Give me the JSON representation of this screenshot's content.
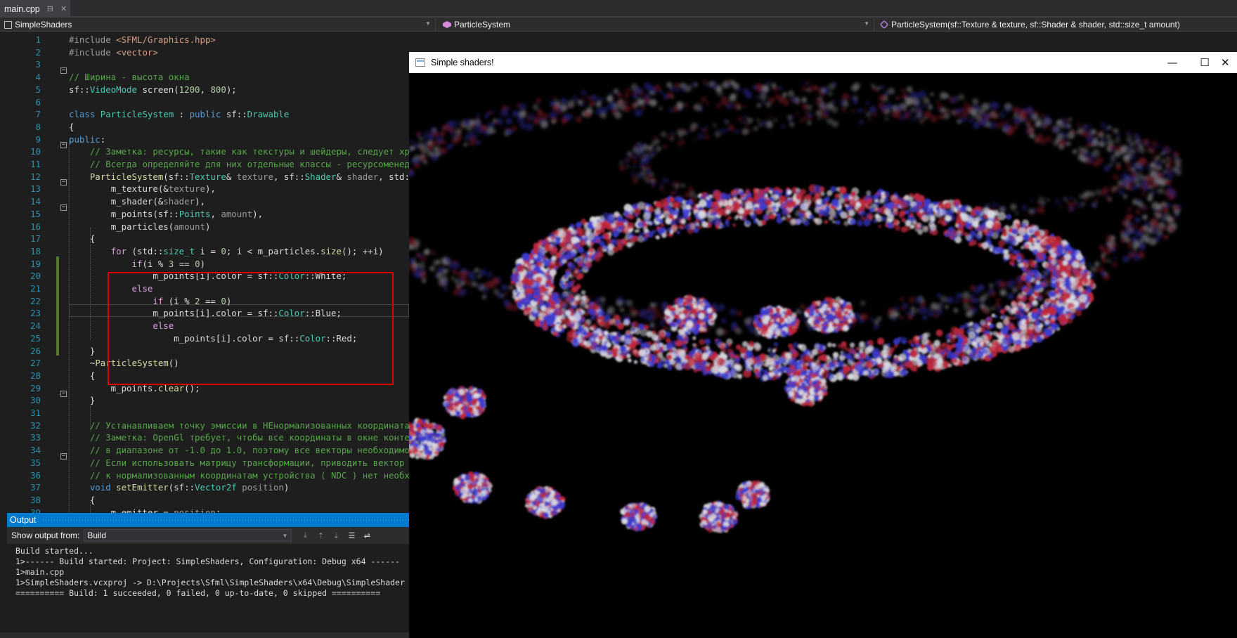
{
  "tab": {
    "title": "main.cpp"
  },
  "nav": {
    "project": "SimpleShaders",
    "class": "ParticleSystem",
    "member": "ParticleSystem(sf::Texture & texture, sf::Shader & shader, std::size_t amount)"
  },
  "code_lines": [
    {
      "n": "1",
      "t": [
        [
          "pp",
          "#include "
        ],
        [
          "str",
          "<SFML/Graphics.hpp>"
        ]
      ]
    },
    {
      "n": "2",
      "t": [
        [
          "pp",
          "#include "
        ],
        [
          "str",
          "<vector>"
        ]
      ]
    },
    {
      "n": "3",
      "t": []
    },
    {
      "n": "4",
      "t": [
        [
          "cm",
          "// Ширина - высота окна"
        ]
      ]
    },
    {
      "n": "5",
      "t": [
        [
          "",
          "sf::"
        ],
        [
          "ty",
          "VideoMode"
        ],
        [
          "",
          " screen("
        ],
        [
          "num",
          "1200"
        ],
        [
          "",
          ", "
        ],
        [
          "num",
          "800"
        ],
        [
          "",
          ");"
        ]
      ]
    },
    {
      "n": "6",
      "t": []
    },
    {
      "n": "7",
      "t": [
        [
          "kw",
          "class "
        ],
        [
          "ty",
          "ParticleSystem"
        ],
        [
          "",
          " : "
        ],
        [
          "kw",
          "public "
        ],
        [
          "",
          "sf::"
        ],
        [
          "ty",
          "Drawable"
        ]
      ]
    },
    {
      "n": "8",
      "t": [
        [
          "",
          "{"
        ]
      ]
    },
    {
      "n": "9",
      "t": [
        [
          "kw",
          "public"
        ],
        [
          "",
          ":"
        ]
      ]
    },
    {
      "n": "10",
      "t": [
        [
          "",
          "    "
        ],
        [
          "cm",
          "// Заметка: ресурсы, такие как текстуры и шейдеры, следует хр"
        ]
      ]
    },
    {
      "n": "11",
      "t": [
        [
          "",
          "    "
        ],
        [
          "cm",
          "// Всегда определяйте для них отдельные классы - ресурсоменед"
        ]
      ]
    },
    {
      "n": "12",
      "t": [
        [
          "",
          "    "
        ],
        [
          "fn",
          "ParticleSystem"
        ],
        [
          "",
          "(sf::"
        ],
        [
          "ty",
          "Texture"
        ],
        [
          "",
          "& "
        ],
        [
          "pm",
          "texture"
        ],
        [
          "",
          ", sf::"
        ],
        [
          "ty",
          "Shader"
        ],
        [
          "",
          "& "
        ],
        [
          "pm",
          "shader"
        ],
        [
          "",
          ", std:"
        ]
      ]
    },
    {
      "n": "13",
      "t": [
        [
          "",
          "        "
        ],
        [
          "mem",
          "m_texture"
        ],
        [
          "",
          "(&"
        ],
        [
          "pm",
          "texture"
        ],
        [
          "",
          "),"
        ]
      ]
    },
    {
      "n": "14",
      "t": [
        [
          "",
          "        "
        ],
        [
          "mem",
          "m_shader"
        ],
        [
          "",
          "(&"
        ],
        [
          "pm",
          "shader"
        ],
        [
          "",
          "),"
        ]
      ]
    },
    {
      "n": "15",
      "t": [
        [
          "",
          "        "
        ],
        [
          "mem",
          "m_points"
        ],
        [
          "",
          "(sf::"
        ],
        [
          "ty",
          "Points"
        ],
        [
          "",
          ", "
        ],
        [
          "pm",
          "amount"
        ],
        [
          "",
          "),"
        ]
      ]
    },
    {
      "n": "16",
      "t": [
        [
          "",
          "        "
        ],
        [
          "mem",
          "m_particles"
        ],
        [
          "",
          "("
        ],
        [
          "pm",
          "amount"
        ],
        [
          "",
          ")"
        ]
      ]
    },
    {
      "n": "17",
      "t": [
        [
          "",
          "    {"
        ]
      ]
    },
    {
      "n": "18",
      "t": [
        [
          "",
          "        "
        ],
        [
          "ctl",
          "for"
        ],
        [
          "",
          " (std::"
        ],
        [
          "ty",
          "size_t"
        ],
        [
          "",
          " i = "
        ],
        [
          "num",
          "0"
        ],
        [
          "",
          "; i < m_particles."
        ],
        [
          "fn",
          "size"
        ],
        [
          "",
          "(); ++i)"
        ]
      ]
    },
    {
      "n": "19",
      "t": [
        [
          "",
          "            "
        ],
        [
          "ctl",
          "if"
        ],
        [
          "",
          "(i % "
        ],
        [
          "num",
          "3"
        ],
        [
          "",
          " == "
        ],
        [
          "num",
          "0"
        ],
        [
          "",
          ")"
        ]
      ]
    },
    {
      "n": "20",
      "t": [
        [
          "",
          "                m_points[i].color = sf::"
        ],
        [
          "ty",
          "Color"
        ],
        [
          "",
          "::White;"
        ]
      ]
    },
    {
      "n": "21",
      "t": [
        [
          "",
          "            "
        ],
        [
          "ctl",
          "else"
        ]
      ]
    },
    {
      "n": "22",
      "t": [
        [
          "",
          "                "
        ],
        [
          "ctl",
          "if"
        ],
        [
          "",
          " (i % "
        ],
        [
          "num",
          "2"
        ],
        [
          "",
          " == "
        ],
        [
          "num",
          "0"
        ],
        [
          "",
          ")"
        ]
      ]
    },
    {
      "n": "23",
      "t": [
        [
          "",
          "                m_points[i].color = sf::"
        ],
        [
          "ty",
          "Color"
        ],
        [
          "",
          "::Blue;"
        ]
      ]
    },
    {
      "n": "24",
      "t": [
        [
          "",
          "                "
        ],
        [
          "ctl",
          "else"
        ]
      ]
    },
    {
      "n": "25",
      "t": [
        [
          "",
          "                    m_points[i].color = sf::"
        ],
        [
          "ty",
          "Color"
        ],
        [
          "",
          "::Red;"
        ]
      ]
    },
    {
      "n": "26",
      "t": [
        [
          "",
          "    }"
        ]
      ]
    },
    {
      "n": "27",
      "t": [
        [
          "",
          "    ~"
        ],
        [
          "fn",
          "ParticleSystem"
        ],
        [
          "",
          "()"
        ]
      ]
    },
    {
      "n": "28",
      "t": [
        [
          "",
          "    {"
        ]
      ]
    },
    {
      "n": "29",
      "t": [
        [
          "",
          "        m_points."
        ],
        [
          "fn",
          "clear"
        ],
        [
          "",
          "();"
        ]
      ]
    },
    {
      "n": "30",
      "t": [
        [
          "",
          "    }"
        ]
      ]
    },
    {
      "n": "31",
      "t": []
    },
    {
      "n": "32",
      "t": [
        [
          "",
          "    "
        ],
        [
          "cm",
          "// Устанавливаем точку эмиссии в НЕнормализованных координата"
        ]
      ]
    },
    {
      "n": "33",
      "t": [
        [
          "",
          "    "
        ],
        [
          "cm",
          "// Заметка: OpenGl требует, чтобы все координаты в окне конте"
        ]
      ]
    },
    {
      "n": "34",
      "t": [
        [
          "",
          "    "
        ],
        [
          "cm",
          "// в диапазоне от -1.0 до 1.0, поэтому все векторы необходимо"
        ]
      ]
    },
    {
      "n": "35",
      "t": [
        [
          "",
          "    "
        ],
        [
          "cm",
          "// Если использовать матрицу трансформации, приводить вектор"
        ]
      ]
    },
    {
      "n": "36",
      "t": [
        [
          "",
          "    "
        ],
        [
          "cm",
          "// к нормализованным координатам устройства ( NDC ) нет необх"
        ]
      ]
    },
    {
      "n": "37",
      "t": [
        [
          "",
          "    "
        ],
        [
          "kw",
          "void "
        ],
        [
          "fn",
          "setEmitter"
        ],
        [
          "",
          "(sf::"
        ],
        [
          "ty",
          "Vector2f"
        ],
        [
          "",
          " "
        ],
        [
          "pm",
          "position"
        ],
        [
          "",
          ")"
        ]
      ]
    },
    {
      "n": "38",
      "t": [
        [
          "",
          "    {"
        ]
      ]
    },
    {
      "n": "39",
      "t": [
        [
          "",
          "        m_emitter = "
        ],
        [
          "pm",
          "position"
        ],
        [
          "",
          ";"
        ]
      ]
    }
  ],
  "output": {
    "title": "Output",
    "show_from_label": "Show output from:",
    "source": "Build",
    "lines": [
      "Build started...",
      "1>------ Build started: Project: SimpleShaders, Configuration: Debug x64 ------",
      "1>main.cpp",
      "1>SimpleShaders.vcxproj -> D:\\Projects\\Sfml\\SimpleShaders\\x64\\Debug\\SimpleShader",
      "========== Build: 1 succeeded, 0 failed, 0 up-to-date, 0 skipped =========="
    ]
  },
  "window": {
    "title": "Simple shaders!"
  },
  "colors": {
    "accent": "#007acc",
    "highlight_box": "#e00000",
    "particle_red": "#c0283a",
    "particle_blue": "#3a3ad0",
    "particle_white": "#d8d8e0"
  }
}
